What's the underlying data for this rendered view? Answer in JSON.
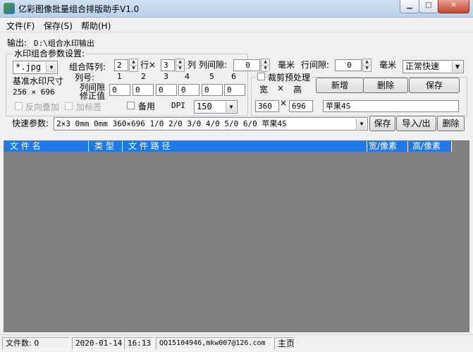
{
  "window": {
    "title": "亿彩图像批量组合排版助手V1.0"
  },
  "menu": [
    "文件(F)",
    "保存(S)",
    "帮助(H)"
  ],
  "output": {
    "label": "输出:",
    "path": "D:\\组合水印输出"
  },
  "params_group": {
    "title": "水印组合参数设置:",
    "format_value": "*.jpg",
    "array_label": "组合阵列:",
    "rows_value": "2",
    "rows_label": "行×",
    "cols_value": "3",
    "cols_label": "列",
    "col_gap_label": "列间隙:",
    "col_gap_value": "0",
    "unit_mm": "毫米",
    "row_gap_label": "行间隙:",
    "row_gap_value": "0",
    "unit_mm2": "毫米",
    "mode_value": "正常快速",
    "base_size_label": "基准水印尺寸",
    "base_size_value": "256 × 696",
    "col_num_label": "列号:",
    "col_numbers": [
      "1",
      "2",
      "3",
      "4",
      "5",
      "6"
    ],
    "col_gap_fix_label1": "列间隙",
    "col_gap_fix_label2": "修正值",
    "col_gap_fix_values": [
      "0",
      "0",
      "0",
      "0",
      "0",
      "0"
    ],
    "reverse_label": "反向叠加",
    "add_tag_label": "加标签",
    "backup_label": "备用",
    "dpi_label": "DPI",
    "dpi_value": "150"
  },
  "crop_group": {
    "title": "裁剪预处理",
    "width_label": "宽",
    "times_label": "×",
    "height_label": "高",
    "width_value": "360",
    "height_value": "696",
    "times_label2": "×",
    "name_value": "苹果4S",
    "add_label": "新增",
    "delete_label": "删除",
    "save_label": "保存"
  },
  "quick": {
    "label": "快速参数:",
    "value": "2×3 0mm 0mm 360×696 1/0 2/0 3/0 4/0 5/0 6/0 苹果4S",
    "save_label": "保存",
    "import_label": "导入/出",
    "delete_label": "删除"
  },
  "list": {
    "columns": [
      "文 件 名",
      "类 型",
      "文 件 路 径",
      "宽/像素",
      "高/像素"
    ]
  },
  "status": {
    "file_count": "文件数: 0",
    "date": "2020-01-14",
    "time": "16:13",
    "contact": "QQ15104946,mkw007@126.com",
    "home": "主页"
  }
}
